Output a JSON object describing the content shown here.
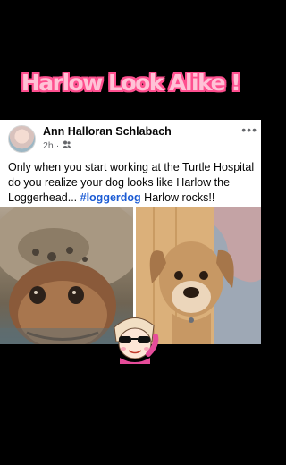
{
  "overlay": {
    "headline": "Harlow Look Alike !"
  },
  "post": {
    "author": "Ann Halloran Schlabach",
    "time": "2h",
    "separator": "·",
    "more": "•••",
    "text_before": "Only when you start working at the Turtle Hospital do you realize your dog looks like Harlow the Loggerhead... ",
    "hashtag": "#loggerdog",
    "text_after": " Harlow rocks!!",
    "icons": {
      "avatar": "profile-photo",
      "audience": "friends-icon",
      "menu": "more-options-icon"
    }
  },
  "colors": {
    "headline_fill": "#ffc2d6",
    "headline_outline": "#ff4f8f",
    "hashtag": "#1b5bd4",
    "background": "#000000"
  }
}
